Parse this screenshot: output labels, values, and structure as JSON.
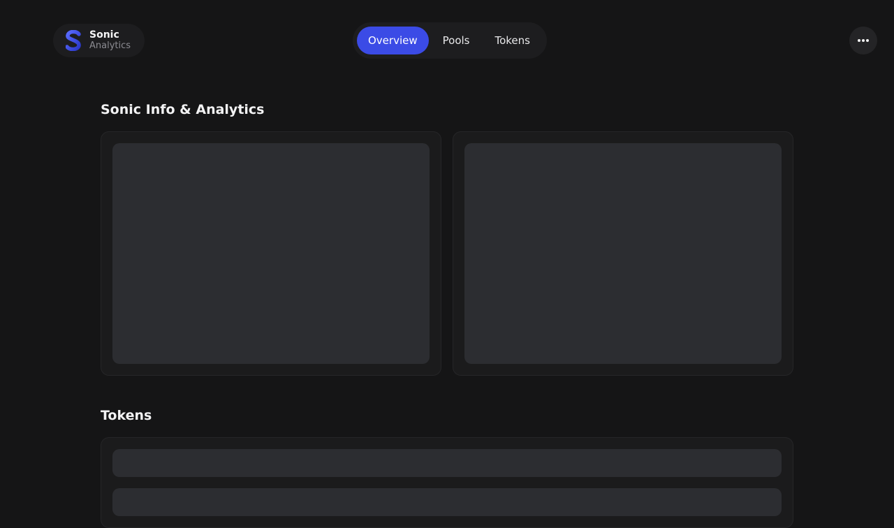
{
  "brand": {
    "name": "Sonic",
    "subtitle": "Analytics",
    "logo_icon": "sonic-s-logo-icon",
    "accent_color": "#3b4be6"
  },
  "nav": {
    "tabs": [
      {
        "label": "Overview",
        "active": true
      },
      {
        "label": "Pools",
        "active": false
      },
      {
        "label": "Tokens",
        "active": false
      }
    ]
  },
  "header": {
    "more_icon": "more-horizontal-icon"
  },
  "sections": {
    "info": {
      "title": "Sonic Info & Analytics"
    },
    "tokens": {
      "title": "Tokens"
    }
  }
}
